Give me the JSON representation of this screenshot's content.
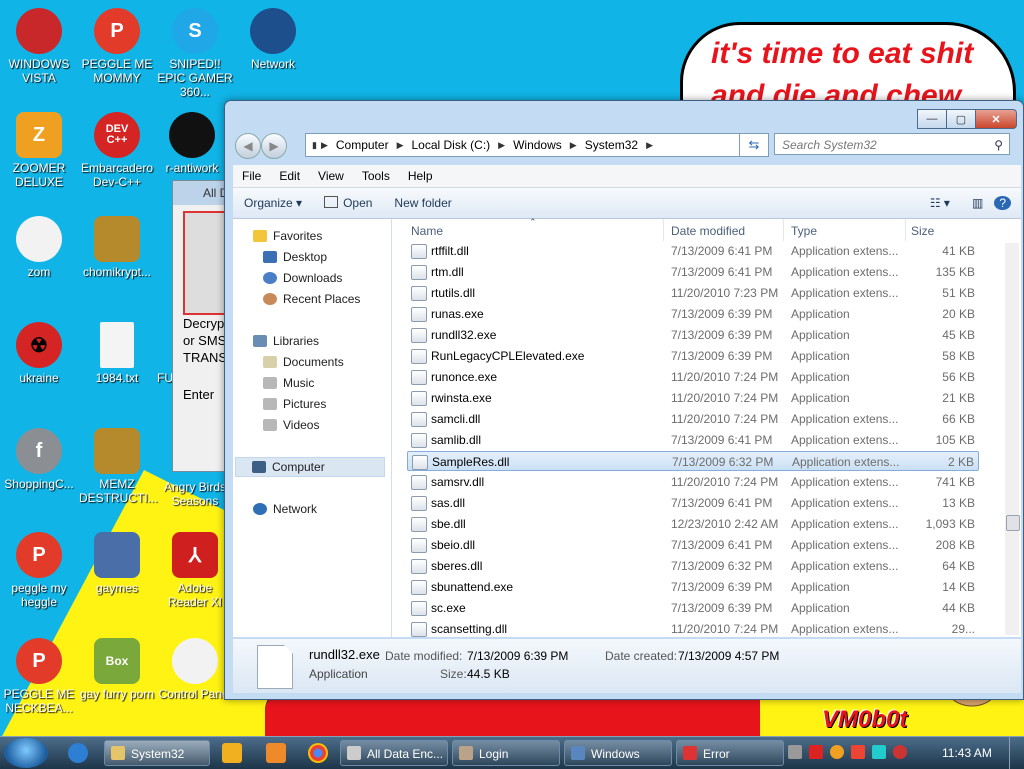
{
  "desktop": {
    "art_text": {
      "line1": "it's time to eat shit",
      "line2": "and die and chew"
    },
    "watermark": "VM0b0t",
    "icons": [
      {
        "label": "WINDOWS VISTA"
      },
      {
        "label": "PEGGLE ME MOMMY"
      },
      {
        "label": "SNIPED!! EPIC GAMER 360..."
      },
      {
        "label": "Network"
      },
      {
        "label": "ZOOMER DELUXE"
      },
      {
        "label": "Embarcadero Dev-C++"
      },
      {
        "label": "r-antiwork"
      },
      {
        "label": "zom"
      },
      {
        "label": "chomikrypt..."
      },
      {
        "label": "ukraine"
      },
      {
        "label": "1984.txt"
      },
      {
        "label": "FU"
      },
      {
        "label": "ShoppingC..."
      },
      {
        "label": "MEMZ DESTRUCTI..."
      },
      {
        "label": "Angry Birds Seasons"
      },
      {
        "label": "peggle my heggle"
      },
      {
        "label": "gaymes"
      },
      {
        "label": "Adobe Reader XI"
      },
      {
        "label": "PEGGLE ME NECKBEA..."
      },
      {
        "label": "gay furry porn"
      },
      {
        "label": "Control Panel"
      }
    ],
    "box_badge": "Box",
    "dev_badge": "DEV C++"
  },
  "back_window": {
    "title": "All D",
    "text_lines": [
      "Decryp",
      "or SMS",
      "TRANS"
    ],
    "enter_label": "Enter"
  },
  "explorer": {
    "caption": {
      "min": "—",
      "max": "▢",
      "close": "✕"
    },
    "back_glyph": "◀",
    "fwd_glyph": "▶",
    "breadcrumb": [
      "Computer",
      "Local Disk (C:)",
      "Windows",
      "System32"
    ],
    "search_placeholder": "Search System32",
    "menu": [
      "File",
      "Edit",
      "View",
      "Tools",
      "Help"
    ],
    "toolbar": {
      "organize": "Organize ▾",
      "open": "Open",
      "new_folder": "New folder"
    },
    "nav": {
      "favorites": "Favorites",
      "desktop": "Desktop",
      "downloads": "Downloads",
      "recent": "Recent Places",
      "libraries": "Libraries",
      "documents": "Documents",
      "music": "Music",
      "pictures": "Pictures",
      "videos": "Videos",
      "computer": "Computer",
      "network": "Network"
    },
    "columns": {
      "name": "Name",
      "date": "Date modified",
      "type": "Type",
      "size": "Size"
    },
    "files": [
      {
        "name": "rtffilt.dll",
        "date": "7/13/2009 6:41 PM",
        "type": "Application extens...",
        "size": "41 KB"
      },
      {
        "name": "rtm.dll",
        "date": "7/13/2009 6:41 PM",
        "type": "Application extens...",
        "size": "135 KB"
      },
      {
        "name": "rtutils.dll",
        "date": "11/20/2010 7:23 PM",
        "type": "Application extens...",
        "size": "51 KB"
      },
      {
        "name": "runas.exe",
        "date": "7/13/2009 6:39 PM",
        "type": "Application",
        "size": "20 KB"
      },
      {
        "name": "rundll32.exe",
        "date": "7/13/2009 6:39 PM",
        "type": "Application",
        "size": "45 KB"
      },
      {
        "name": "RunLegacyCPLElevated.exe",
        "date": "7/13/2009 6:39 PM",
        "type": "Application",
        "size": "58 KB"
      },
      {
        "name": "runonce.exe",
        "date": "11/20/2010 7:24 PM",
        "type": "Application",
        "size": "56 KB"
      },
      {
        "name": "rwinsta.exe",
        "date": "11/20/2010 7:24 PM",
        "type": "Application",
        "size": "21 KB"
      },
      {
        "name": "samcli.dll",
        "date": "11/20/2010 7:24 PM",
        "type": "Application extens...",
        "size": "66 KB"
      },
      {
        "name": "samlib.dll",
        "date": "7/13/2009 6:41 PM",
        "type": "Application extens...",
        "size": "105 KB"
      },
      {
        "name": "SampleRes.dll",
        "date": "7/13/2009 6:32 PM",
        "type": "Application extens...",
        "size": "2 KB"
      },
      {
        "name": "samsrv.dll",
        "date": "11/20/2010 7:24 PM",
        "type": "Application extens...",
        "size": "741 KB"
      },
      {
        "name": "sas.dll",
        "date": "7/13/2009 6:41 PM",
        "type": "Application extens...",
        "size": "13 KB"
      },
      {
        "name": "sbe.dll",
        "date": "12/23/2010 2:42 AM",
        "type": "Application extens...",
        "size": "1,093 KB"
      },
      {
        "name": "sbeio.dll",
        "date": "7/13/2009 6:41 PM",
        "type": "Application extens...",
        "size": "208 KB"
      },
      {
        "name": "sberes.dll",
        "date": "7/13/2009 6:32 PM",
        "type": "Application extens...",
        "size": "64 KB"
      },
      {
        "name": "sbunattend.exe",
        "date": "7/13/2009 6:39 PM",
        "type": "Application",
        "size": "14 KB"
      },
      {
        "name": "sc.exe",
        "date": "7/13/2009 6:39 PM",
        "type": "Application",
        "size": "44 KB"
      },
      {
        "name": "scansetting.dll",
        "date": "11/20/2010 7:24 PM",
        "type": "Application extens...",
        "size": "29..."
      }
    ],
    "details": {
      "filename": "rundll32.exe",
      "type": "Application",
      "modified_label": "Date modified:",
      "modified": "7/13/2009 6:39 PM",
      "size_label": "Size:",
      "size": "44.5 KB",
      "created_label": "Date created:",
      "created": "7/13/2009 4:57 PM"
    }
  },
  "taskbar": {
    "buttons": [
      {
        "label": "System32"
      },
      {
        "label": "All Data Enc..."
      },
      {
        "label": "Login"
      },
      {
        "label": "Windows"
      },
      {
        "label": "Error"
      }
    ],
    "clock": "11:43 AM"
  },
  "colors": {
    "desktop": "#10b4e6",
    "accent": "#2a67b5",
    "art_red": "#e8141c",
    "art_yellow": "#fff314"
  }
}
